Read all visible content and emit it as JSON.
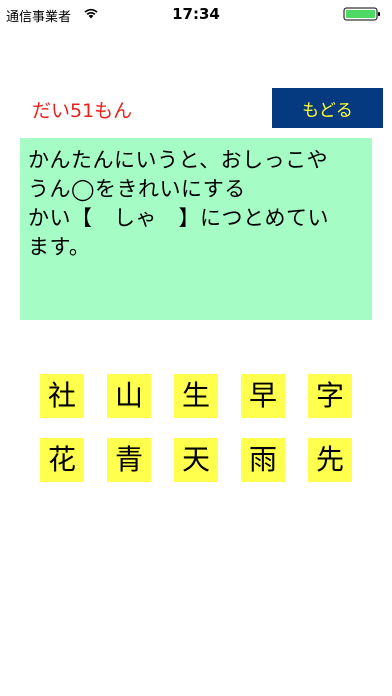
{
  "status_bar": {
    "carrier": "通信事業者",
    "time": "17:34"
  },
  "header": {
    "question_number": "だい51もん",
    "back_label": "もどる"
  },
  "question": {
    "lines": [
      "かんたんにいうと、おしっこや",
      "うん◯をきれいにする",
      "かい【　しゃ　】につとめてい",
      "ます。"
    ]
  },
  "choices": {
    "row1": [
      "社",
      "山",
      "生",
      "早",
      "字"
    ],
    "row2": [
      "花",
      "青",
      "天",
      "雨",
      "先"
    ]
  },
  "colors": {
    "question_number": "#e8211d",
    "back_button_bg": "#053a80",
    "back_button_text": "#ffff33",
    "question_box_bg": "#a5fcc4",
    "choice_bg": "#ffff4d",
    "battery": "#4cd964"
  },
  "icons": {
    "wifi": "wifi-icon",
    "battery": "battery-icon"
  }
}
